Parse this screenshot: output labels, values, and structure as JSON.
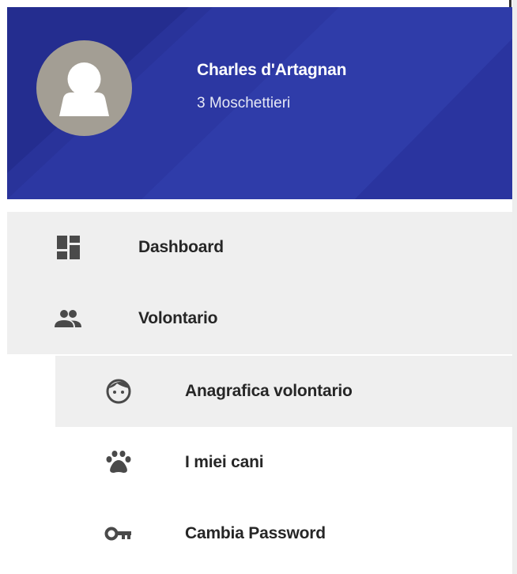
{
  "header": {
    "user_name": "Charles d'Artagnan",
    "user_org": "3 Moschettieri",
    "bg_color": "#29339a"
  },
  "menu": {
    "items": [
      {
        "label": "Dashboard",
        "icon": "dashboard-icon"
      },
      {
        "label": "Volontario",
        "icon": "people-icon"
      }
    ],
    "subitems": [
      {
        "label": "Anagrafica volontario",
        "icon": "face-icon"
      },
      {
        "label": "I miei cani",
        "icon": "paw-icon"
      },
      {
        "label": "Cambia Password",
        "icon": "key-icon"
      }
    ]
  },
  "colors": {
    "active_bg": "#efefef",
    "icon_color": "#4a4a4a",
    "text_color": "#262626"
  }
}
